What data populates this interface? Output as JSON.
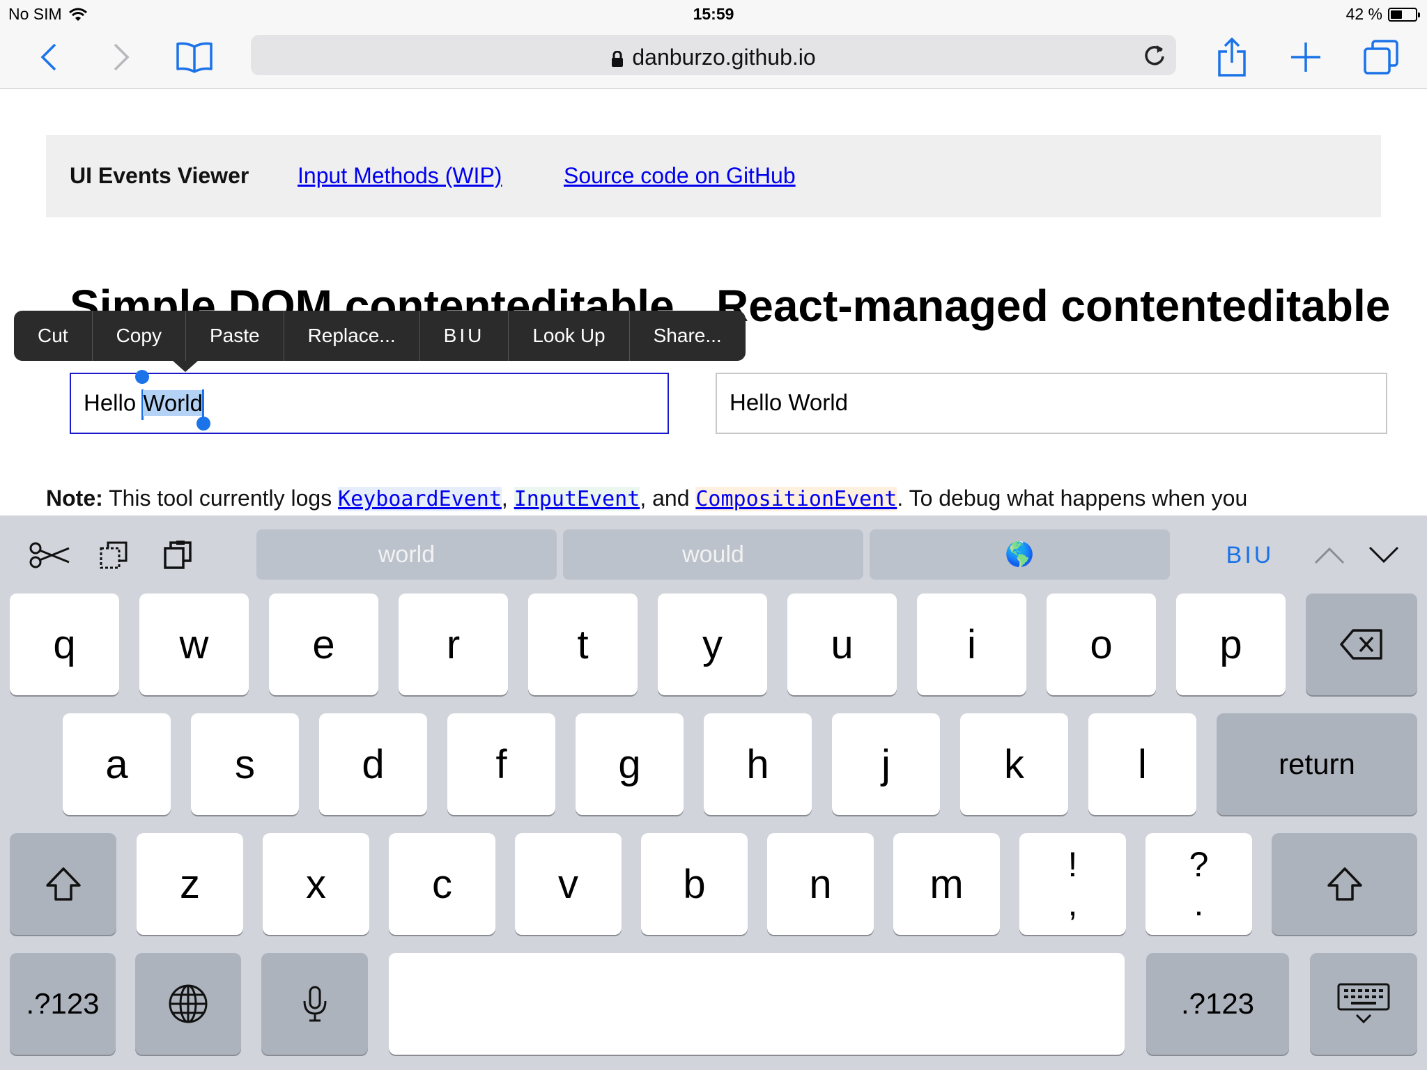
{
  "status_bar": {
    "carrier": "No SIM",
    "time": "15:59",
    "battery": "42 %",
    "battery_level": 0.42
  },
  "browser": {
    "url": "danburzo.github.io"
  },
  "page": {
    "nav": {
      "brand": "UI Events Viewer",
      "link1": "Input Methods (WIP)",
      "link2": "Source code on GitHub"
    },
    "heading_left": "Simple DOM contenteditable",
    "heading_right": "React-managed contenteditable",
    "editor_left": {
      "word1": "Hello",
      "selected": "World"
    },
    "editor_right": {
      "text": "Hello World"
    },
    "note": {
      "label": "Note:",
      "text1": " This tool currently logs ",
      "code1": "KeyboardEvent",
      "sep1": ", ",
      "code2": "InputEvent",
      "sep2": ", and ",
      "code3": "CompositionEvent",
      "text2": ". To debug what happens when you"
    }
  },
  "callout_menu": [
    "Cut",
    "Copy",
    "Paste",
    "Replace...",
    "BIU",
    "Look Up",
    "Share..."
  ],
  "keyboard": {
    "suggestions": [
      "world",
      "would",
      "🌎"
    ],
    "format_label": "BIU",
    "row1": [
      "q",
      "w",
      "e",
      "r",
      "t",
      "y",
      "u",
      "i",
      "o",
      "p"
    ],
    "row2": [
      "a",
      "s",
      "d",
      "f",
      "g",
      "h",
      "j",
      "k",
      "l"
    ],
    "return_label": "return",
    "row3": [
      "z",
      "x",
      "c",
      "v",
      "b",
      "n",
      "m"
    ],
    "punct1": {
      "top": "!",
      "bottom": ","
    },
    "punct2": {
      "top": "?",
      "bottom": "."
    },
    "numbers_label": ".?123"
  }
}
